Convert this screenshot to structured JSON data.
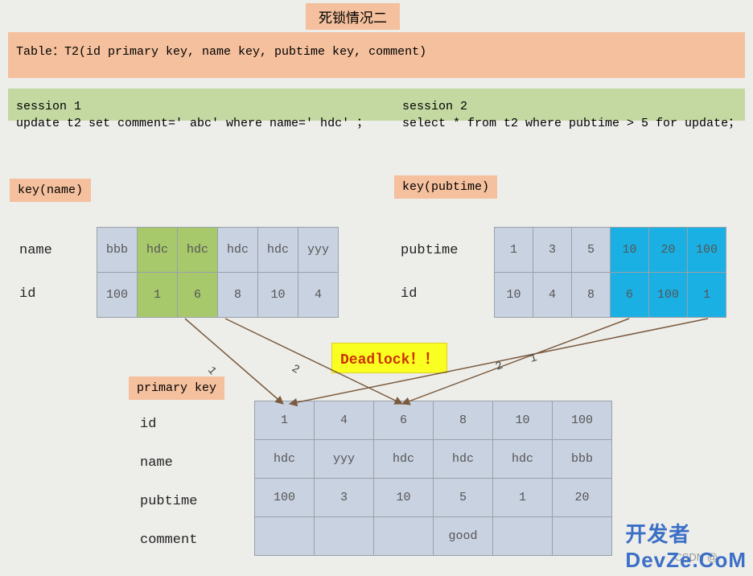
{
  "title": "死锁情况二",
  "table_decl": "Table：T2(id primary key, name key, pubtime key, comment)",
  "sessions": {
    "s1_label": "session 1",
    "s1_sql": "update t2 set comment=' abc'  where name=' hdc' ；",
    "s2_label": "session 2",
    "s2_sql": "select * from t2 where pubtime > 5 for update；"
  },
  "tags": {
    "key_name": "key(name)",
    "key_pubtime": "key(pubtime)",
    "primary_key": "primary key"
  },
  "left_table": {
    "row_labels": [
      "name",
      "id"
    ],
    "rows": [
      [
        "bbb",
        "hdc",
        "hdc",
        "hdc",
        "hdc",
        "yyy"
      ],
      [
        "100",
        "1",
        "6",
        "8",
        "10",
        "4"
      ]
    ],
    "highlight_cols": [
      1,
      2
    ],
    "highlight_class": "cell-green"
  },
  "right_table": {
    "row_labels": [
      "pubtime",
      "id"
    ],
    "rows": [
      [
        "1",
        "3",
        "5",
        "10",
        "20",
        "100"
      ],
      [
        "10",
        "4",
        "8",
        "6",
        "100",
        "1"
      ]
    ],
    "highlight_cols": [
      3,
      4,
      5
    ],
    "highlight_class": "cell-blue"
  },
  "main_table": {
    "row_labels": [
      "id",
      "name",
      "pubtime",
      "comment"
    ],
    "rows": [
      [
        "1",
        "4",
        "6",
        "8",
        "10",
        "100"
      ],
      [
        "hdc",
        "yyy",
        "hdc",
        "hdc",
        "hdc",
        "bbb"
      ],
      [
        "100",
        "3",
        "10",
        "5",
        "1",
        "20"
      ],
      [
        "",
        "",
        "",
        "good",
        "",
        ""
      ]
    ]
  },
  "deadlock_text": "Deadlock！！",
  "arrow_labels": {
    "left1": "1",
    "left2": "2",
    "right1": "1",
    "right2": "2"
  },
  "watermark_csdn": "CSDN @",
  "watermark_kfz_cn": "开发者",
  "watermark_kfz_en": "DevZe.CoM"
}
